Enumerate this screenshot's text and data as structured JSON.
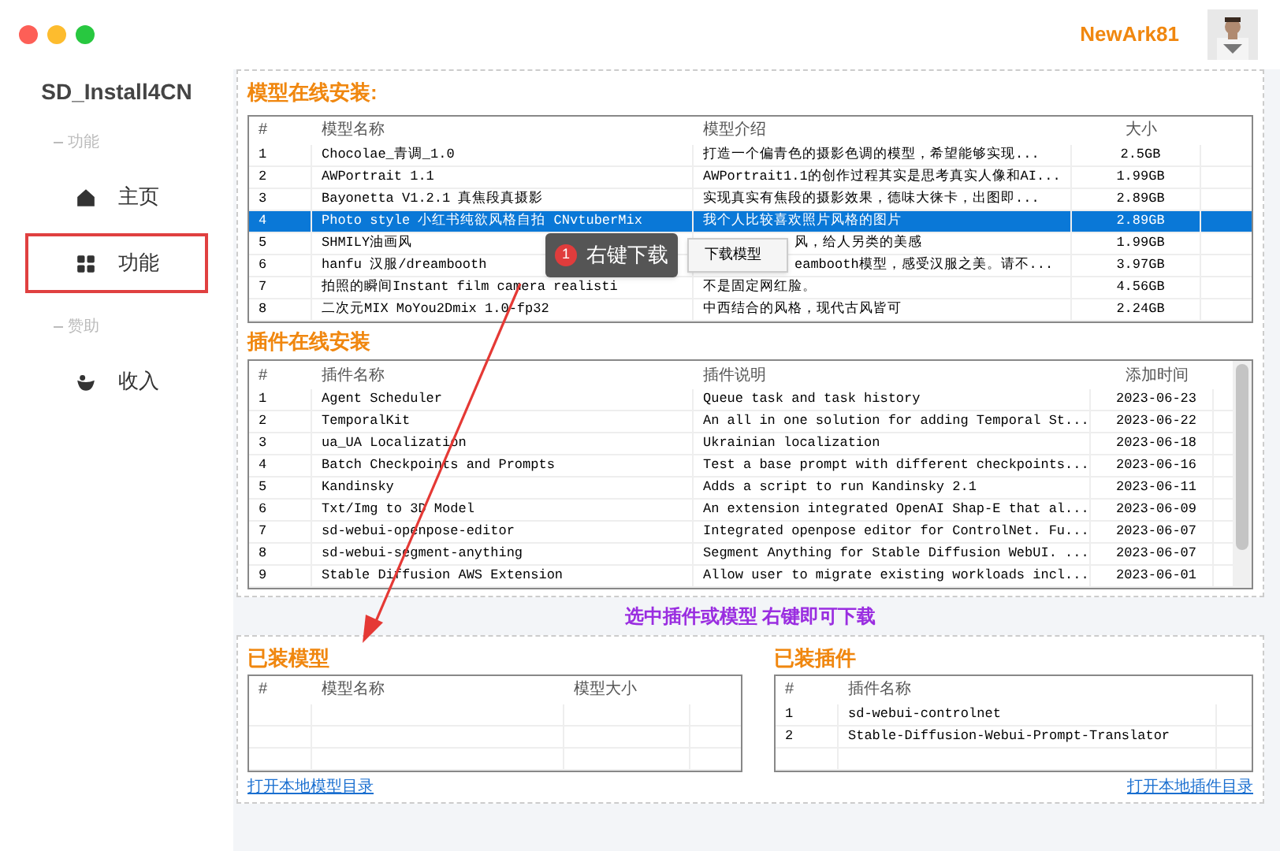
{
  "window": {
    "user": "NewArk81"
  },
  "sidebar": {
    "title": "SD_Install4CN",
    "groups": [
      {
        "label": "功能",
        "items": [
          {
            "label": "主页",
            "selected": false
          },
          {
            "label": "功能",
            "selected": true
          }
        ]
      },
      {
        "label": "赞助",
        "items": [
          {
            "label": "收入",
            "selected": false
          }
        ]
      }
    ]
  },
  "models_online": {
    "title": "模型在线安装:",
    "columns": [
      "#",
      "模型名称",
      "模型介绍",
      "大小"
    ],
    "rows": [
      {
        "cells": [
          "1",
          "Chocolae_青调_1.0",
          "打造一个偏青色的摄影色调的模型，希望能够实现...",
          "2.5GB"
        ],
        "selected": false,
        "under_menu": false
      },
      {
        "cells": [
          "2",
          "AWPortrait 1.1",
          "AWPortrait1.1的创作过程其实是思考真实人像和AI...",
          "1.99GB"
        ],
        "selected": false,
        "under_menu": false
      },
      {
        "cells": [
          "3",
          "Bayonetta V1.2.1 真焦段真摄影",
          "实现真实有焦段的摄影效果，德味大徕卡，出图即...",
          "2.89GB"
        ],
        "selected": false,
        "under_menu": false
      },
      {
        "cells": [
          "4",
          "Photo style 小红书纯欲风格自拍 CNvtuberMix",
          "我个人比较喜欢照片风格的图片",
          "2.89GB"
        ],
        "selected": true,
        "under_menu": false
      },
      {
        "cells": [
          "5",
          "SHMILY油画风",
          "风，给人另类的美感",
          "1.99GB"
        ],
        "selected": false,
        "under_menu": true
      },
      {
        "cells": [
          "6",
          "hanfu 汉服/dreambooth",
          "eambooth模型，感受汉服之美。请不...",
          "3.97GB"
        ],
        "selected": false,
        "under_menu": true
      },
      {
        "cells": [
          "7",
          "拍照的瞬间Instant film camera realisti",
          "不是固定网红脸。",
          "4.56GB"
        ],
        "selected": false,
        "under_menu": false
      },
      {
        "cells": [
          "8",
          "二次元MIX MoYou2Dmix 1.0-fp32",
          "中西结合的风格，现代古风皆可",
          "2.24GB"
        ],
        "selected": false,
        "under_menu": false
      }
    ],
    "callout": {
      "badge": "1",
      "text": "右键下载"
    },
    "context_menu": [
      "下载模型"
    ]
  },
  "plugins_online": {
    "title": "插件在线安装",
    "columns": [
      "#",
      "插件名称",
      "插件说明",
      "添加时间"
    ],
    "rows": [
      [
        "1",
        "Agent Scheduler",
        "Queue task and task history",
        "2023-06-23"
      ],
      [
        "2",
        "TemporalKit",
        "An all in one solution for adding Temporal St...",
        "2023-06-22"
      ],
      [
        "3",
        "ua_UA Localization",
        "Ukrainian localization",
        "2023-06-18"
      ],
      [
        "4",
        "Batch Checkpoints and Prompts",
        "Test a base prompt with different checkpoints...",
        "2023-06-16"
      ],
      [
        "5",
        "Kandinsky",
        "Adds a script to run Kandinsky 2.1",
        "2023-06-11"
      ],
      [
        "6",
        "Txt/Img to 3D Model",
        "An extension integrated OpenAI Shap-E that al...",
        "2023-06-09"
      ],
      [
        "7",
        "sd-webui-openpose-editor",
        "Integrated openpose editor for ControlNet. Fu...",
        "2023-06-07"
      ],
      [
        "8",
        "sd-webui-segment-anything",
        "Segment Anything for Stable Diffusion WebUI. ...",
        "2023-06-07"
      ],
      [
        "9",
        "Stable Diffusion AWS Extension",
        "Allow user to migrate existing workloads incl...",
        "2023-06-01"
      ]
    ]
  },
  "hint": "选中插件或模型 右键即可下载",
  "installed_models": {
    "title": "已装模型",
    "columns": [
      "#",
      "模型名称",
      "模型大小"
    ],
    "link": "打开本地模型目录"
  },
  "installed_plugins": {
    "title": "已装插件",
    "columns": [
      "#",
      "插件名称"
    ],
    "rows": [
      [
        "1",
        "sd-webui-controlnet"
      ],
      [
        "2",
        "Stable-Diffusion-Webui-Prompt-Translator"
      ]
    ],
    "link": "打开本地插件目录"
  }
}
